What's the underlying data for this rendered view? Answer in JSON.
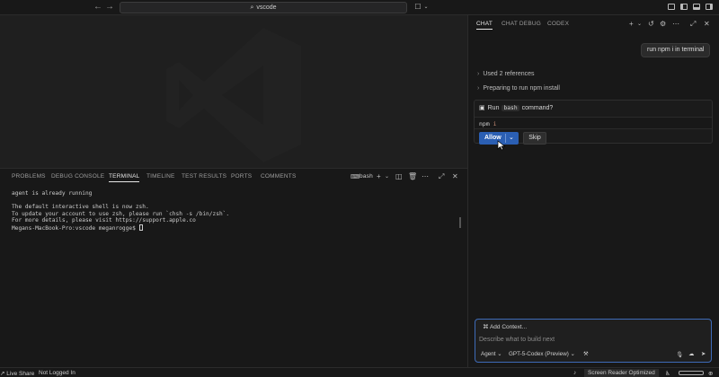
{
  "titlebar": {
    "back_icon": "arrow-left-icon",
    "forward_icon": "arrow-right-icon",
    "search_text": "vscode",
    "copilot_icon": "copilot-icon"
  },
  "panel": {
    "tabs": [
      "PROBLEMS",
      "DEBUG CONSOLE",
      "TERMINAL",
      "TIMELINE",
      "TEST RESULTS",
      "PORTS",
      "COMMENTS"
    ],
    "active_tab": "TERMINAL",
    "shell_label": "bash",
    "terminal_lines": [
      "agent is already running",
      "",
      "The default interactive shell is now zsh.",
      "To update your account to use zsh, please run `chsh -s /bin/zsh`.",
      "For more details, please visit https://support.apple.co"
    ],
    "prompt": "Megans-MacBook-Pro:vscode meganrogge$ "
  },
  "chat": {
    "tabs": [
      "CHAT",
      "CHAT DEBUG",
      "CODEX"
    ],
    "active_tab": "CHAT",
    "user_message": "run npm i in terminal",
    "progress": [
      "Used 2 references",
      "Preparing to run npm install"
    ],
    "tool_run_label": "Run",
    "tool_shell": "bash",
    "tool_suffix": "command?",
    "command_name": "npm",
    "command_arg": "i",
    "allow_label": "Allow",
    "skip_label": "Skip",
    "add_context_label": "Add Context...",
    "input_placeholder": "Describe what to build next",
    "mode_label": "Agent",
    "model_label": "GPT-5-Codex (Preview)"
  },
  "statusbar": {
    "live_share": "Live Share",
    "login": "Not Logged In",
    "screen_reader": "Screen Reader Optimized"
  },
  "colors": {
    "accent": "#2b5fb3",
    "input_focus": "#3e6bb8",
    "background": "#181818"
  }
}
